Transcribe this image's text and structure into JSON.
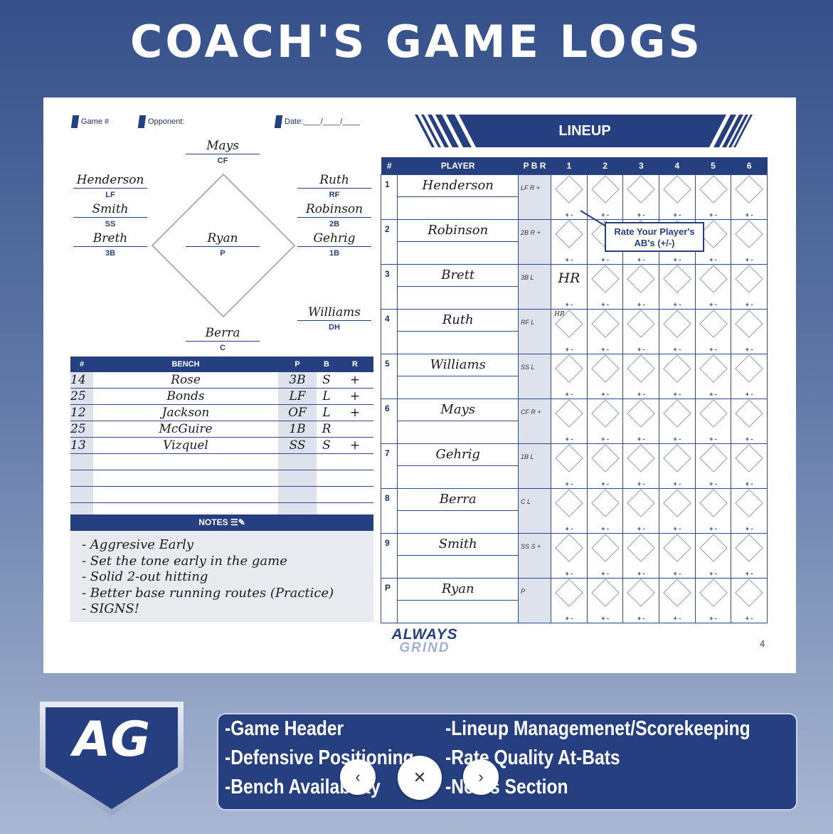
{
  "title": "COACH'S GAME LOGS",
  "header": {
    "game_label": "Game #",
    "opponent_label": "Opponent:",
    "date_label": "Date:____/____/____"
  },
  "field": [
    {
      "name": "Mays",
      "pos": "CF"
    },
    {
      "name": "Henderson",
      "pos": "LF"
    },
    {
      "name": "Smith",
      "pos": "SS"
    },
    {
      "name": "Breth",
      "pos": "3B"
    },
    {
      "name": "Ruth",
      "pos": "RF"
    },
    {
      "name": "Robinson",
      "pos": "2B"
    },
    {
      "name": "Gehrig",
      "pos": "1B"
    },
    {
      "name": "Ryan",
      "pos": "P"
    },
    {
      "name": "Williams",
      "pos": "DH"
    },
    {
      "name": "Berra",
      "pos": "C"
    }
  ],
  "bench": {
    "headers": [
      "#",
      "BENCH",
      "P",
      "B",
      "R"
    ],
    "rows": [
      [
        "14",
        "Rose",
        "3B",
        "S",
        "+"
      ],
      [
        "25",
        "Bonds",
        "LF",
        "L",
        "+"
      ],
      [
        "12",
        "Jackson",
        "OF",
        "L",
        "+"
      ],
      [
        "25",
        "McGuire",
        "1B",
        "R",
        ""
      ],
      [
        "13",
        "Vizquel",
        "SS",
        "S",
        "+"
      ]
    ]
  },
  "notes": {
    "title": "NOTES",
    "lines": [
      "- Aggresive Early",
      "- Set the tone early in the game",
      "- Solid 2-out hitting",
      "- Better base running routes (Practice)",
      "- SIGNS!"
    ]
  },
  "lineup": {
    "title": "LINEUP",
    "headers": [
      "#",
      "PLAYER",
      "P B R",
      "1",
      "2",
      "3",
      "4",
      "5",
      "6"
    ],
    "rows": [
      {
        "num": "1",
        "player": "Henderson",
        "pbr": "LF R +"
      },
      {
        "num": "2",
        "player": "Robinson",
        "pbr": "2B R +"
      },
      {
        "num": "3",
        "player": "Brett",
        "pbr": "3B L"
      },
      {
        "num": "4",
        "player": "Ruth",
        "pbr": "RF L"
      },
      {
        "num": "5",
        "player": "Williams",
        "pbr": "SS L"
      },
      {
        "num": "6",
        "player": "Mays",
        "pbr": "CF R +"
      },
      {
        "num": "7",
        "player": "Gehrig",
        "pbr": "1B L"
      },
      {
        "num": "8",
        "player": "Berra",
        "pbr": "C L"
      },
      {
        "num": "9",
        "player": "Smith",
        "pbr": "SS S +"
      },
      {
        "num": "P",
        "player": "Ryan",
        "pbr": "P"
      }
    ],
    "plus_minus": "+ -",
    "hr_mark": "HR",
    "hr_small": "HR",
    "callout": "Rate Your Player's AB's (+/-)"
  },
  "brand": {
    "line1": "ALWAYS",
    "line2": "GRIND"
  },
  "page_number": "4",
  "logo_text": "AG",
  "features": {
    "left": [
      "-Game Header",
      "-Defensive Positioning",
      "-Bench Availability"
    ],
    "right": [
      "-Lineup Managemenet/Scorekeeping",
      "-Rate Quality At-Bats",
      "-Notes Section"
    ]
  },
  "colors": {
    "navy": "#253f80",
    "background_top": "#35508a",
    "background_bottom": "#a9b7d3"
  }
}
